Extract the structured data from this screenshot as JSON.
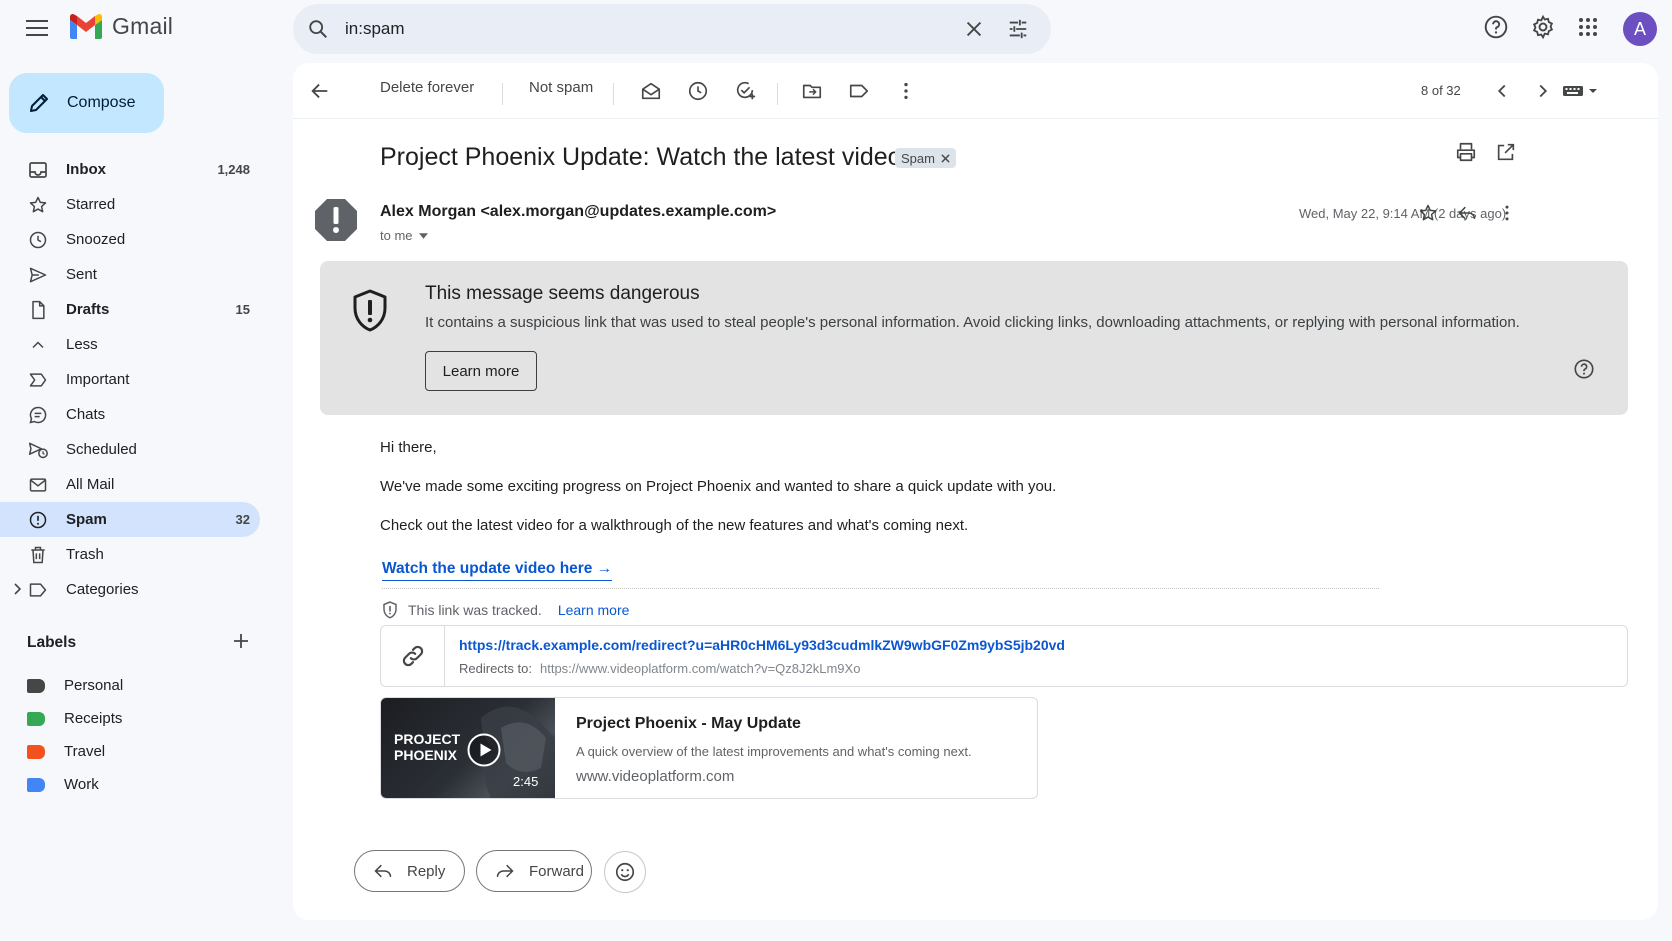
{
  "app": {
    "name": "Gmail"
  },
  "search": {
    "query": "in:spam"
  },
  "account": {
    "initial": "A"
  },
  "sidebar": {
    "compose_label": "Compose",
    "items": [
      {
        "label": "Inbox",
        "count": "1,248",
        "icon": "inbox-icon"
      },
      {
        "label": "Starred",
        "count": "",
        "icon": "star-icon"
      },
      {
        "label": "Snoozed",
        "count": "",
        "icon": "clock-icon"
      },
      {
        "label": "Sent",
        "count": "",
        "icon": "send-icon"
      },
      {
        "label": "Drafts",
        "count": "15",
        "icon": "draft-icon"
      },
      {
        "label": "Less",
        "count": "",
        "icon": "chevron-up-icon"
      },
      {
        "label": "Important",
        "count": "",
        "icon": "important-icon"
      },
      {
        "label": "Chats",
        "count": "",
        "icon": "chat-icon"
      },
      {
        "label": "Scheduled",
        "count": "",
        "icon": "scheduled-icon"
      },
      {
        "label": "All Mail",
        "count": "",
        "icon": "all-mail-icon"
      },
      {
        "label": "Spam",
        "count": "32",
        "icon": "spam-icon"
      },
      {
        "label": "Trash",
        "count": "",
        "icon": "trash-icon"
      },
      {
        "label": "Categories",
        "count": "",
        "icon": "label-icon"
      }
    ],
    "labels_heading": "Labels",
    "labels": [
      {
        "name": "Personal",
        "color": "#444746"
      },
      {
        "name": "Receipts",
        "color": "#34a853"
      },
      {
        "name": "Travel",
        "color": "#f4511e"
      },
      {
        "name": "Work",
        "color": "#4285f4"
      }
    ]
  },
  "toolbar": {
    "delete_forever": "Delete forever",
    "not_spam": "Not spam",
    "pager": "8 of 32"
  },
  "email": {
    "subject": "Project Phoenix Update: Watch the latest video",
    "spam_chip": "Spam",
    "sender": "Alex Morgan <alex.morgan@updates.example.com>",
    "to": "to me",
    "date": "Wed, May 22, 9:14 AM (2 days ago)",
    "warning": {
      "title": "This message seems dangerous",
      "text": "It contains a suspicious link that was used to steal people's personal information. Avoid clicking links, downloading attachments, or replying with personal information.",
      "button": "Learn more"
    },
    "greeting": "Hi there,",
    "para1": "We've made some exciting progress on Project Phoenix and wanted to share a quick update with you.",
    "para2": "Check out the latest video for a walkthrough of the new features and what's coming next.",
    "link_text": "Watch the update video here →",
    "tracked_text": "This link was tracked.",
    "tracked_learn": "Learn more",
    "tracked_url": "https://track.example.com/redirect?u=aHR0cHM6Ly93d3cudmlkZW9wbGF0Zm9ybS5jb20vd",
    "redirects_label": "Redirects to:",
    "redirect_url": "https://www.videoplatform.com/watch?v=Qz8J2kLm9Xo",
    "video": {
      "thumb_title": "PROJECT PHOENIX",
      "duration": "2:45",
      "title": "Project Phoenix - May Update",
      "description": "A quick overview of the latest improvements and what's coming next.",
      "domain": "www.videoplatform.com"
    },
    "reply_label": "Reply",
    "forward_label": "Forward"
  }
}
